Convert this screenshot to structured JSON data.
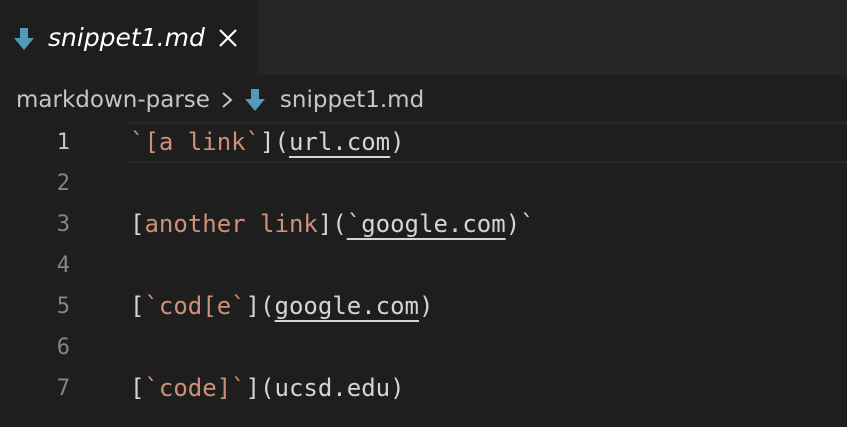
{
  "tab": {
    "label": "snippet1.md",
    "icon": "markdown-file-icon",
    "close_icon": "close-icon"
  },
  "breadcrumb": {
    "folder": "markdown-parse",
    "separator_icon": "chevron-right-icon",
    "file_icon": "markdown-file-icon",
    "file": "snippet1.md"
  },
  "editor": {
    "active_line": 1,
    "lines": [
      {
        "number": "1",
        "tokens": [
          {
            "type": "text",
            "value": "`[a link`"
          },
          {
            "type": "punc",
            "value": "]("
          },
          {
            "type": "url",
            "value": "url.com"
          },
          {
            "type": "punc",
            "value": ")"
          }
        ]
      },
      {
        "number": "2",
        "tokens": []
      },
      {
        "number": "3",
        "tokens": [
          {
            "type": "punc",
            "value": "["
          },
          {
            "type": "text",
            "value": "another link"
          },
          {
            "type": "punc",
            "value": "]("
          },
          {
            "type": "url",
            "value": "`google.com"
          },
          {
            "type": "punc",
            "value": ")`"
          }
        ]
      },
      {
        "number": "4",
        "tokens": []
      },
      {
        "number": "5",
        "tokens": [
          {
            "type": "punc",
            "value": "["
          },
          {
            "type": "text",
            "value": "`cod[e`"
          },
          {
            "type": "punc",
            "value": "]("
          },
          {
            "type": "url",
            "value": "google.com"
          },
          {
            "type": "punc",
            "value": ")"
          }
        ]
      },
      {
        "number": "6",
        "tokens": []
      },
      {
        "number": "7",
        "tokens": [
          {
            "type": "punc",
            "value": "["
          },
          {
            "type": "text",
            "value": "`code]`"
          },
          {
            "type": "punc",
            "value": "](ucsd.edu)"
          }
        ]
      }
    ]
  },
  "colors": {
    "background": "#1e1e1e",
    "tab_bar": "#252526",
    "markdown_icon": "#519aba",
    "link_text": "#ce9178",
    "plain_text": "#d4d4d4",
    "line_number": "#858585",
    "active_line_number": "#c6c6c6"
  }
}
